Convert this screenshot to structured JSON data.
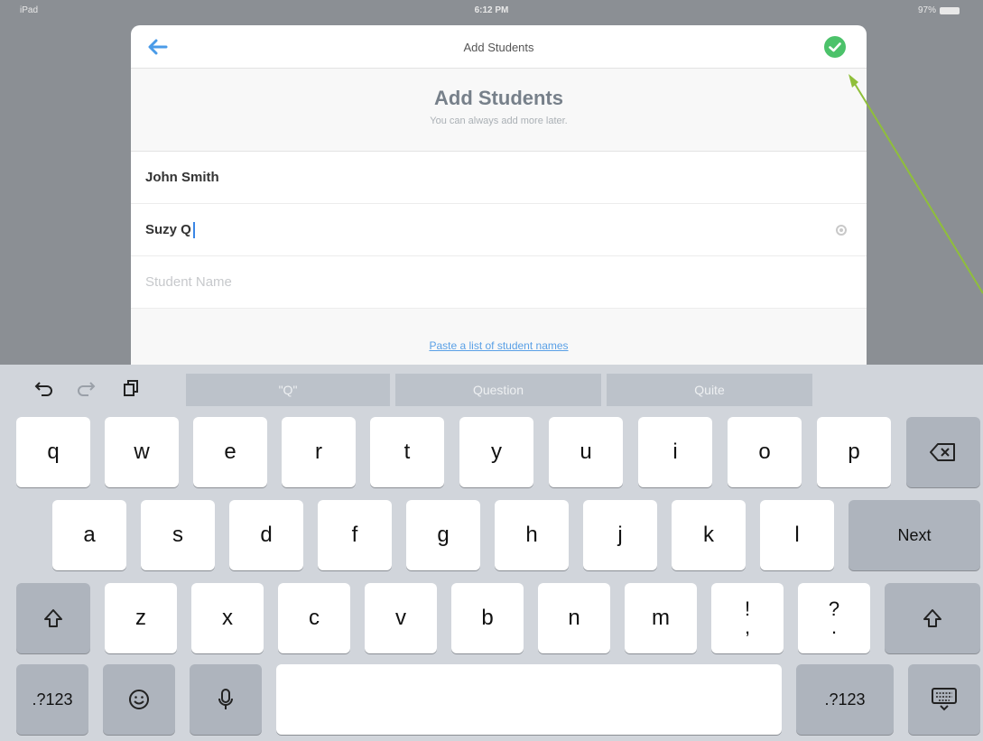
{
  "status_bar": {
    "device": "iPad",
    "time": "6:12 PM",
    "battery": "97%"
  },
  "nav": {
    "title": "Add Students",
    "back_icon": "arrow-left-icon",
    "done_icon": "checkmark-circle-icon",
    "accent_color": "#4a9be8",
    "done_color": "#4cc26a"
  },
  "header": {
    "title": "Add Students",
    "subtitle": "You can always add more later."
  },
  "students": [
    {
      "name": "John Smith"
    },
    {
      "name": "Suzy Q"
    }
  ],
  "new_student": {
    "placeholder": "Student Name"
  },
  "paste_link": "Paste a list of student names",
  "keyboard": {
    "suggestions": [
      "\"Q\"",
      "Question",
      "Quite"
    ],
    "row1": [
      "q",
      "w",
      "e",
      "r",
      "t",
      "y",
      "u",
      "i",
      "o",
      "p"
    ],
    "row2": [
      "a",
      "s",
      "d",
      "f",
      "g",
      "h",
      "j",
      "k",
      "l"
    ],
    "row3": [
      "z",
      "x",
      "c",
      "v",
      "b",
      "n",
      "m"
    ],
    "punct1": [
      "!",
      ","
    ],
    "punct2": [
      "?",
      "."
    ],
    "next_label": "Next",
    "numbers_label": ".?123"
  }
}
